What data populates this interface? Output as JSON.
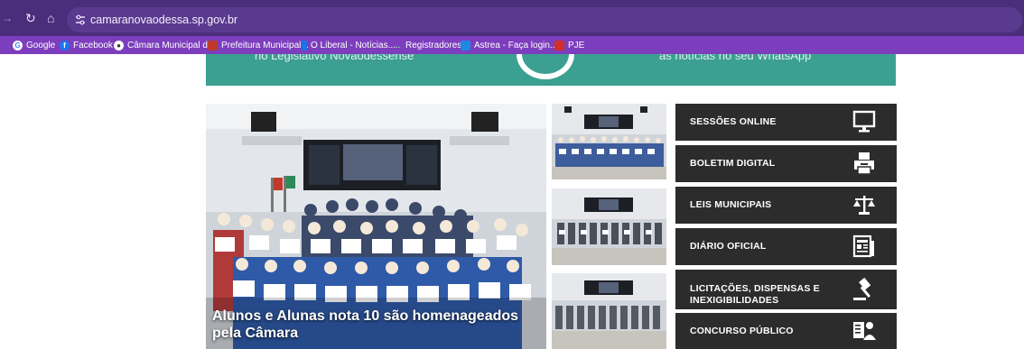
{
  "browser": {
    "url": "camaranovaodessa.sp.gov.br",
    "bookmarks": [
      {
        "label": "Google",
        "icon": "google-icon",
        "color": "#4285f4"
      },
      {
        "label": "Facebook",
        "icon": "facebook-icon",
        "color": "#1877f2"
      },
      {
        "label": "Câmara Municipal d...",
        "icon": "globe-icon",
        "color": "#5f6368"
      },
      {
        "label": "Prefeitura Municipal...",
        "icon": "crest-icon",
        "color": "#c0392b"
      },
      {
        "label": "O Liberal - Notícias...",
        "icon": "bookmark-icon",
        "color": "#1a73e8"
      },
      {
        "label": "Registradores",
        "icon": "registry-icon",
        "color": "#2e7d32"
      },
      {
        "label": "Astrea - Faça login...",
        "icon": "astrea-icon",
        "color": "#1e88e5"
      },
      {
        "label": "PJE",
        "icon": "pje-icon",
        "color": "#d32f2f"
      }
    ]
  },
  "banner": {
    "left_text": "no Legislativo Novaodessense",
    "right_text": "as notícias no seu WhatsApp",
    "color": "#3b9f91"
  },
  "featured": {
    "caption": "Alunos e Alunas nota 10 são homenageados pela Câmara"
  },
  "menu": [
    {
      "label": "SESSÕES ONLINE",
      "icon": "monitor-icon"
    },
    {
      "label": "BOLETIM DIGITAL",
      "icon": "printer-icon"
    },
    {
      "label": "LEIS MUNICIPAIS",
      "icon": "scales-icon"
    },
    {
      "label": "DIÁRIO OFICIAL",
      "icon": "newspaper-icon"
    },
    {
      "label": "LICITAÇÕES, DISPENSAS E INEXIGIBILIDADES",
      "icon": "gavel-icon"
    },
    {
      "label": "CONCURSO PÚBLICO",
      "icon": "exam-icon"
    }
  ],
  "colors": {
    "chrome": "#4a2e7c",
    "bookmarks_bar": "#7c3ebd",
    "menu_bg": "#2c2c2c"
  }
}
